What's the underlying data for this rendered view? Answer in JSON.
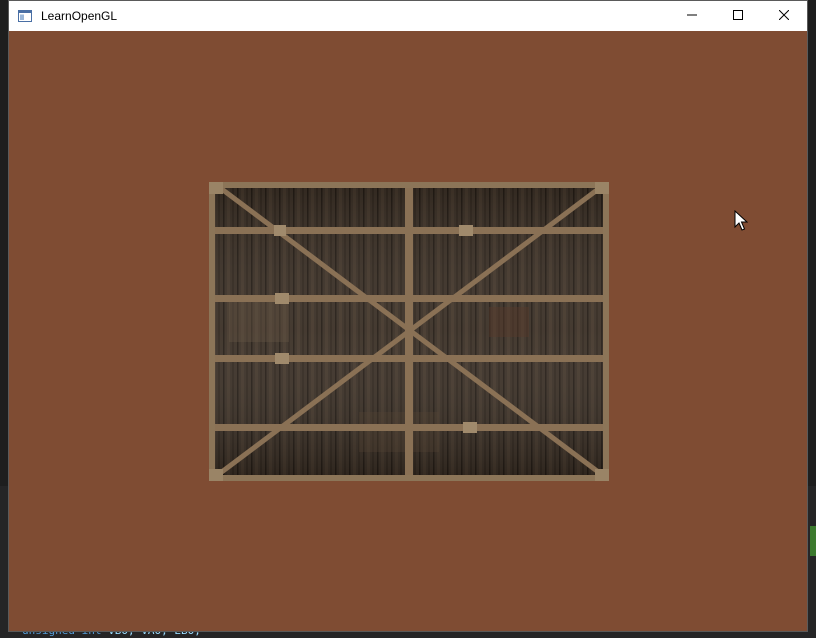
{
  "window": {
    "title": "LearnOpenGL",
    "icon": "app-window-icon",
    "buttons": {
      "minimize_icon": "minimize-icon",
      "maximize_icon": "maximize-icon",
      "close_icon": "close-icon"
    }
  },
  "viewport": {
    "clear_color": "#7f4c33",
    "quad_texture": "wooden-container-texture"
  },
  "background_editor": {
    "code_line": {
      "type": "unsigned int",
      "vars": "VBO, VAO, EBO;"
    }
  },
  "colors": {
    "clear_color": "#7f4c33",
    "wood_dark": "#3b3026",
    "wood_frame": "#8a7155"
  }
}
